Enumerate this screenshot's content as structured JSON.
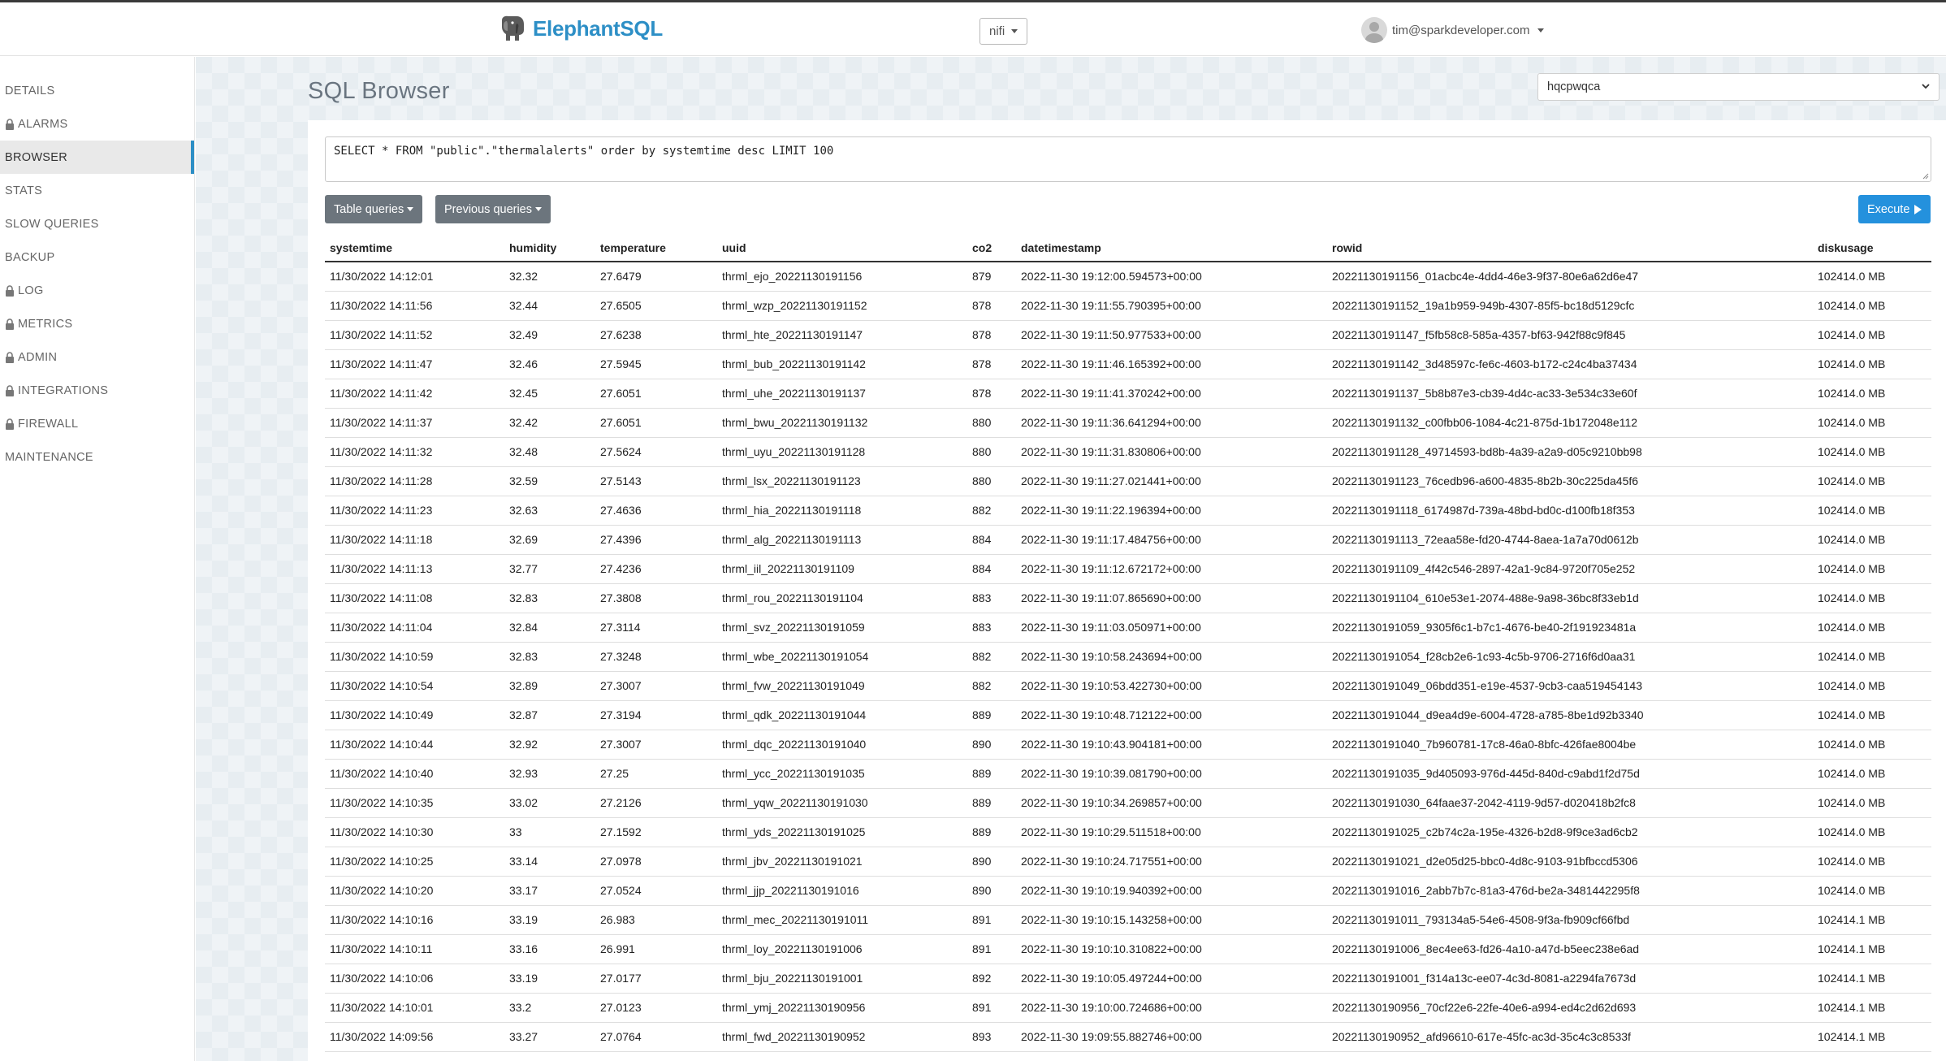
{
  "header": {
    "brand": "ElephantSQL",
    "instance": "nifi",
    "user_email": "tim@sparkdeveloper.com"
  },
  "sidebar": {
    "items": [
      {
        "label": "DETAILS",
        "locked": false,
        "active": false
      },
      {
        "label": "ALARMS",
        "locked": true,
        "active": false
      },
      {
        "label": "BROWSER",
        "locked": false,
        "active": true
      },
      {
        "label": "STATS",
        "locked": false,
        "active": false
      },
      {
        "label": "SLOW QUERIES",
        "locked": false,
        "active": false
      },
      {
        "label": "BACKUP",
        "locked": false,
        "active": false
      },
      {
        "label": "LOG",
        "locked": true,
        "active": false
      },
      {
        "label": "METRICS",
        "locked": true,
        "active": false
      },
      {
        "label": "ADMIN",
        "locked": true,
        "active": false
      },
      {
        "label": "INTEGRATIONS",
        "locked": true,
        "active": false
      },
      {
        "label": "FIREWALL",
        "locked": true,
        "active": false
      },
      {
        "label": "MAINTENANCE",
        "locked": false,
        "active": false
      }
    ]
  },
  "main": {
    "title": "SQL Browser",
    "database": "hqcpwqca",
    "query": "SELECT * FROM \"public\".\"thermalalerts\" order by systemtime desc LIMIT 100",
    "buttons": {
      "table_queries": "Table queries",
      "previous_queries": "Previous queries",
      "execute": "Execute"
    },
    "columns": [
      "systemtime",
      "humidity",
      "temperature",
      "uuid",
      "co2",
      "datetimestamp",
      "rowid",
      "diskusage"
    ],
    "rows": [
      [
        "11/30/2022 14:12:01",
        "32.32",
        "27.6479",
        "thrml_ejo_20221130191156",
        "879",
        "2022-11-30 19:12:00.594573+00:00",
        "20221130191156_01acbc4e-4dd4-46e3-9f37-80e6a62d6e47",
        "102414.0 MB"
      ],
      [
        "11/30/2022 14:11:56",
        "32.44",
        "27.6505",
        "thrml_wzp_20221130191152",
        "878",
        "2022-11-30 19:11:55.790395+00:00",
        "20221130191152_19a1b959-949b-4307-85f5-bc18d5129cfc",
        "102414.0 MB"
      ],
      [
        "11/30/2022 14:11:52",
        "32.49",
        "27.6238",
        "thrml_hte_20221130191147",
        "878",
        "2022-11-30 19:11:50.977533+00:00",
        "20221130191147_f5fb58c8-585a-4357-bf63-942f88c9f845",
        "102414.0 MB"
      ],
      [
        "11/30/2022 14:11:47",
        "32.46",
        "27.5945",
        "thrml_bub_20221130191142",
        "878",
        "2022-11-30 19:11:46.165392+00:00",
        "20221130191142_3d48597c-fe6c-4603-b172-c24c4ba37434",
        "102414.0 MB"
      ],
      [
        "11/30/2022 14:11:42",
        "32.45",
        "27.6051",
        "thrml_uhe_20221130191137",
        "878",
        "2022-11-30 19:11:41.370242+00:00",
        "20221130191137_5b8b87e3-cb39-4d4c-ac33-3e534c33e60f",
        "102414.0 MB"
      ],
      [
        "11/30/2022 14:11:37",
        "32.42",
        "27.6051",
        "thrml_bwu_20221130191132",
        "880",
        "2022-11-30 19:11:36.641294+00:00",
        "20221130191132_c00fbb06-1084-4c21-875d-1b172048e112",
        "102414.0 MB"
      ],
      [
        "11/30/2022 14:11:32",
        "32.48",
        "27.5624",
        "thrml_uyu_20221130191128",
        "880",
        "2022-11-30 19:11:31.830806+00:00",
        "20221130191128_49714593-bd8b-4a39-a2a9-d05c9210bb98",
        "102414.0 MB"
      ],
      [
        "11/30/2022 14:11:28",
        "32.59",
        "27.5143",
        "thrml_lsx_20221130191123",
        "880",
        "2022-11-30 19:11:27.021441+00:00",
        "20221130191123_76cedb96-a600-4835-8b2b-30c225da45f6",
        "102414.0 MB"
      ],
      [
        "11/30/2022 14:11:23",
        "32.63",
        "27.4636",
        "thrml_hia_20221130191118",
        "882",
        "2022-11-30 19:11:22.196394+00:00",
        "20221130191118_6174987d-739a-48bd-bd0c-d100fb18f353",
        "102414.0 MB"
      ],
      [
        "11/30/2022 14:11:18",
        "32.69",
        "27.4396",
        "thrml_alg_20221130191113",
        "884",
        "2022-11-30 19:11:17.484756+00:00",
        "20221130191113_72eaa58e-fd20-4744-8aea-1a7a70d0612b",
        "102414.0 MB"
      ],
      [
        "11/30/2022 14:11:13",
        "32.77",
        "27.4236",
        "thrml_iil_20221130191109",
        "884",
        "2022-11-30 19:11:12.672172+00:00",
        "20221130191109_4f42c546-2897-42a1-9c84-9720f705e252",
        "102414.0 MB"
      ],
      [
        "11/30/2022 14:11:08",
        "32.83",
        "27.3808",
        "thrml_rou_20221130191104",
        "883",
        "2022-11-30 19:11:07.865690+00:00",
        "20221130191104_610e53e1-2074-488e-9a98-36bc8f33eb1d",
        "102414.0 MB"
      ],
      [
        "11/30/2022 14:11:04",
        "32.84",
        "27.3114",
        "thrml_svz_20221130191059",
        "883",
        "2022-11-30 19:11:03.050971+00:00",
        "20221130191059_9305f6c1-b7c1-4676-be40-2f191923481a",
        "102414.0 MB"
      ],
      [
        "11/30/2022 14:10:59",
        "32.83",
        "27.3248",
        "thrml_wbe_20221130191054",
        "882",
        "2022-11-30 19:10:58.243694+00:00",
        "20221130191054_f28cb2e6-1c93-4c5b-9706-2716f6d0aa31",
        "102414.0 MB"
      ],
      [
        "11/30/2022 14:10:54",
        "32.89",
        "27.3007",
        "thrml_fvw_20221130191049",
        "882",
        "2022-11-30 19:10:53.422730+00:00",
        "20221130191049_06bdd351-e19e-4537-9cb3-caa519454143",
        "102414.0 MB"
      ],
      [
        "11/30/2022 14:10:49",
        "32.87",
        "27.3194",
        "thrml_qdk_20221130191044",
        "889",
        "2022-11-30 19:10:48.712122+00:00",
        "20221130191044_d9ea4d9e-6004-4728-a785-8be1d92b3340",
        "102414.0 MB"
      ],
      [
        "11/30/2022 14:10:44",
        "32.92",
        "27.3007",
        "thrml_dqc_20221130191040",
        "890",
        "2022-11-30 19:10:43.904181+00:00",
        "20221130191040_7b960781-17c8-46a0-8bfc-426fae8004be",
        "102414.0 MB"
      ],
      [
        "11/30/2022 14:10:40",
        "32.93",
        "27.25",
        "thrml_ycc_20221130191035",
        "889",
        "2022-11-30 19:10:39.081790+00:00",
        "20221130191035_9d405093-976d-445d-840d-c9abd1f2d75d",
        "102414.0 MB"
      ],
      [
        "11/30/2022 14:10:35",
        "33.02",
        "27.2126",
        "thrml_yqw_20221130191030",
        "889",
        "2022-11-30 19:10:34.269857+00:00",
        "20221130191030_64faae37-2042-4119-9d57-d020418b2fc8",
        "102414.0 MB"
      ],
      [
        "11/30/2022 14:10:30",
        "33",
        "27.1592",
        "thrml_yds_20221130191025",
        "889",
        "2022-11-30 19:10:29.511518+00:00",
        "20221130191025_c2b74c2a-195e-4326-b2d8-9f9ce3ad6cb2",
        "102414.0 MB"
      ],
      [
        "11/30/2022 14:10:25",
        "33.14",
        "27.0978",
        "thrml_jbv_20221130191021",
        "890",
        "2022-11-30 19:10:24.717551+00:00",
        "20221130191021_d2e05d25-bbc0-4d8c-9103-91bfbccd5306",
        "102414.0 MB"
      ],
      [
        "11/30/2022 14:10:20",
        "33.17",
        "27.0524",
        "thrml_jjp_20221130191016",
        "890",
        "2022-11-30 19:10:19.940392+00:00",
        "20221130191016_2abb7b7c-81a3-476d-be2a-3481442295f8",
        "102414.0 MB"
      ],
      [
        "11/30/2022 14:10:16",
        "33.19",
        "26.983",
        "thrml_mec_20221130191011",
        "891",
        "2022-11-30 19:10:15.143258+00:00",
        "20221130191011_793134a5-54e6-4508-9f3a-fb909cf66fbd",
        "102414.1 MB"
      ],
      [
        "11/30/2022 14:10:11",
        "33.16",
        "26.991",
        "thrml_loy_20221130191006",
        "891",
        "2022-11-30 19:10:10.310822+00:00",
        "20221130191006_8ec4ee63-fd26-4a10-a47d-b5eec238e6ad",
        "102414.1 MB"
      ],
      [
        "11/30/2022 14:10:06",
        "33.19",
        "27.0177",
        "thrml_bju_20221130191001",
        "892",
        "2022-11-30 19:10:05.497244+00:00",
        "20221130191001_f314a13c-ee07-4c3d-8081-a2294fa7673d",
        "102414.1 MB"
      ],
      [
        "11/30/2022 14:10:01",
        "33.2",
        "27.0123",
        "thrml_ymj_20221130190956",
        "891",
        "2022-11-30 19:10:00.724686+00:00",
        "20221130190956_70cf22e6-22fe-40e6-a994-ed4c2d62d693",
        "102414.1 MB"
      ],
      [
        "11/30/2022 14:09:56",
        "33.27",
        "27.0764",
        "thrml_fwd_20221130190952",
        "893",
        "2022-11-30 19:09:55.882746+00:00",
        "20221130190952_afd96610-617e-45fc-ac3d-35c4c3c8533f",
        "102414.1 MB"
      ]
    ]
  },
  "colors": {
    "brand": "#2d8fc6",
    "execute": "#2491dd",
    "gray_button": "#6c757d"
  }
}
